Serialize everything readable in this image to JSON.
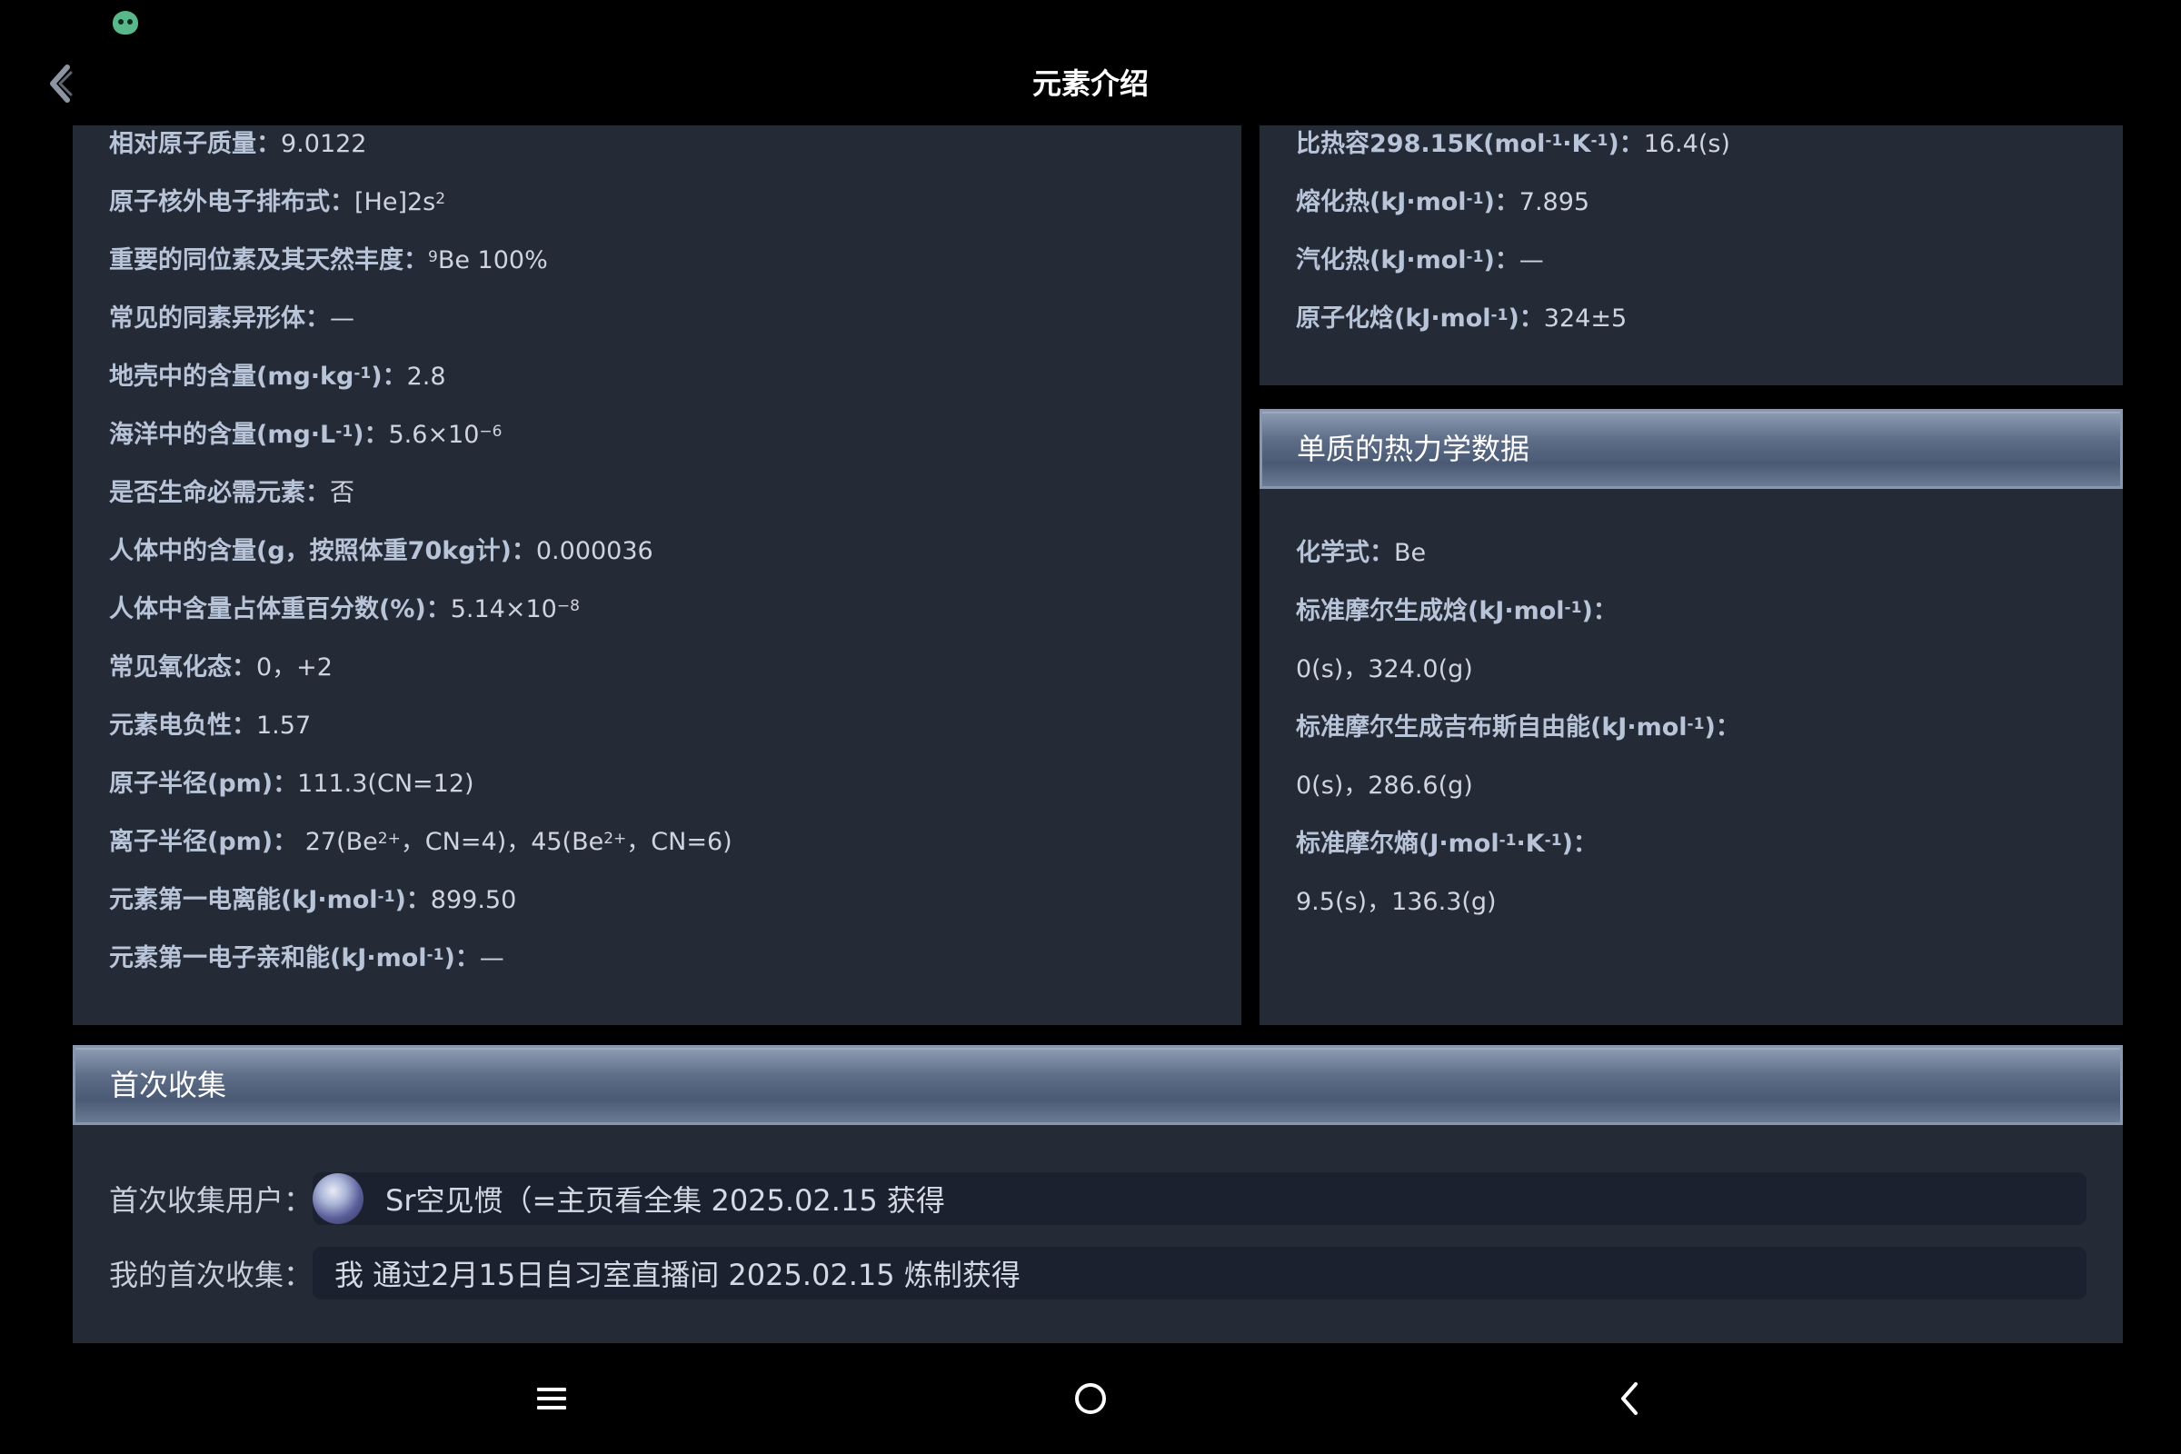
{
  "header": {
    "title": "元素介绍"
  },
  "basic": {
    "rows": [
      {
        "k": "相对原子质量：",
        "v": "9.0122"
      },
      {
        "k": "原子核外电子排布式：",
        "v": "[He]2s<sup>2</sup>"
      },
      {
        "k": "重要的同位素及其天然丰度：",
        "v": "<sup>9</sup>Be 100%"
      },
      {
        "k": "常见的同素异形体：",
        "v": "—"
      },
      {
        "k": "地壳中的含量(mg·kg<sup>-1</sup>)：",
        "v": "2.8"
      },
      {
        "k": "海洋中的含量(mg·L<sup>-1</sup>)：",
        "v": "5.6×10<sup>−6</sup>"
      },
      {
        "k": "是否生命必需元素：",
        "v": "否"
      },
      {
        "k": "人体中的含量(g，按照体重70kg计)：",
        "v": "0.000036"
      },
      {
        "k": "人体中含量占体重百分数(%)：",
        "v": "5.14×10<sup>−8</sup>"
      },
      {
        "k": "常见氧化态：",
        "v": "0，+2"
      },
      {
        "k": "元素电负性：",
        "v": "1.57"
      },
      {
        "k": "原子半径(pm)：",
        "v": "111.3(CN=12)"
      },
      {
        "k": "离子半径(pm)：",
        "v": " 27(Be<sup>2+</sup>，CN=4)，45(Be<sup>2+</sup>，CN=6)"
      },
      {
        "k": "元素第一电离能(kJ·mol<sup>-1</sup>)：",
        "v": "899.50"
      },
      {
        "k": "元素第一电子亲和能(kJ·mol<sup>-1</sup>)：",
        "v": "—"
      }
    ]
  },
  "thermal": {
    "rows": [
      {
        "k": "比热容298.15K(mol<sup>-1</sup>·K<sup>-1</sup>)：",
        "v": "16.4(s)"
      },
      {
        "k": "熔化热(kJ·mol<sup>-1</sup>)：",
        "v": "7.895"
      },
      {
        "k": "汽化热(kJ·mol<sup>-1</sup>)：",
        "v": "—"
      },
      {
        "k": "原子化焓(kJ·mol<sup>-1</sup>)：",
        "v": "324±5"
      }
    ]
  },
  "substance": {
    "title": "单质的热力学数据",
    "rows": [
      {
        "k": "化学式：",
        "v": "Be"
      },
      {
        "k": "标准摩尔生成焓(kJ·mol<sup>-1</sup>)：",
        "v": ""
      },
      {
        "k": "",
        "v": "0(s)，324.0(g)"
      },
      {
        "k": "标准摩尔生成吉布斯自由能(kJ·mol<sup>-1</sup>)：",
        "v": ""
      },
      {
        "k": "",
        "v": "0(s)，286.6(g)"
      },
      {
        "k": "标准摩尔熵(J·mol<sup>-1</sup>·K<sup>-1</sup>)：",
        "v": ""
      },
      {
        "k": "",
        "v": "9.5(s)，136.3(g)"
      }
    ]
  },
  "first": {
    "title": "首次收集",
    "user_label": "首次收集用户：",
    "user_value": "Sr空见惯（=主页看全集  2025.02.15 获得",
    "mine_label": "我的首次收集：",
    "mine_value": "我 通过2月15日自习室直播间 2025.02.15 炼制获得"
  },
  "icons": {
    "status": "app-notification-icon",
    "back": "back-arrow-icon",
    "nav_menu": "menu-icon",
    "nav_home": "home-icon",
    "nav_back": "back-icon"
  }
}
